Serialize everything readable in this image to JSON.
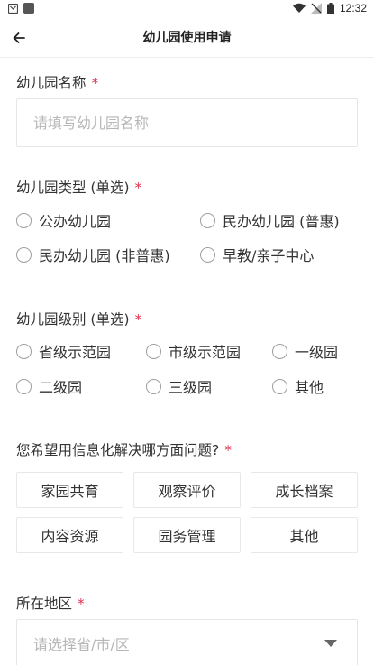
{
  "status_bar": {
    "time": "12:32",
    "icons": [
      "notification-icon",
      "app-icon",
      "wifi-icon",
      "signal-off-icon",
      "battery-icon"
    ]
  },
  "header": {
    "title": "幼儿园使用申请",
    "back_icon": "arrow-left-icon"
  },
  "colors": {
    "required": "#e0304e",
    "border": "#e6e6e6",
    "placeholder": "#b7b7b7"
  },
  "form": {
    "name": {
      "label": "幼儿园名称",
      "required_mark": "*",
      "placeholder": "请填写幼儿园名称"
    },
    "type": {
      "label": "幼儿园类型 (单选)",
      "required_mark": "*",
      "options": [
        "公办幼儿园",
        "民办幼儿园 (普惠)",
        "民办幼儿园 (非普惠)",
        "早教/亲子中心"
      ]
    },
    "level": {
      "label": "幼儿园级别 (单选)",
      "required_mark": "*",
      "options": [
        "省级示范园",
        "市级示范园",
        "一级园",
        "二级园",
        "三级园",
        "其他"
      ]
    },
    "problems": {
      "label": "您希望用信息化解决哪方面问题?",
      "required_mark": "*",
      "options": [
        "家园共育",
        "观察评价",
        "成长档案",
        "内容资源",
        "园务管理",
        "其他"
      ]
    },
    "region": {
      "label": "所在地区",
      "required_mark": "*",
      "placeholder": "请选择省/市/区"
    }
  }
}
